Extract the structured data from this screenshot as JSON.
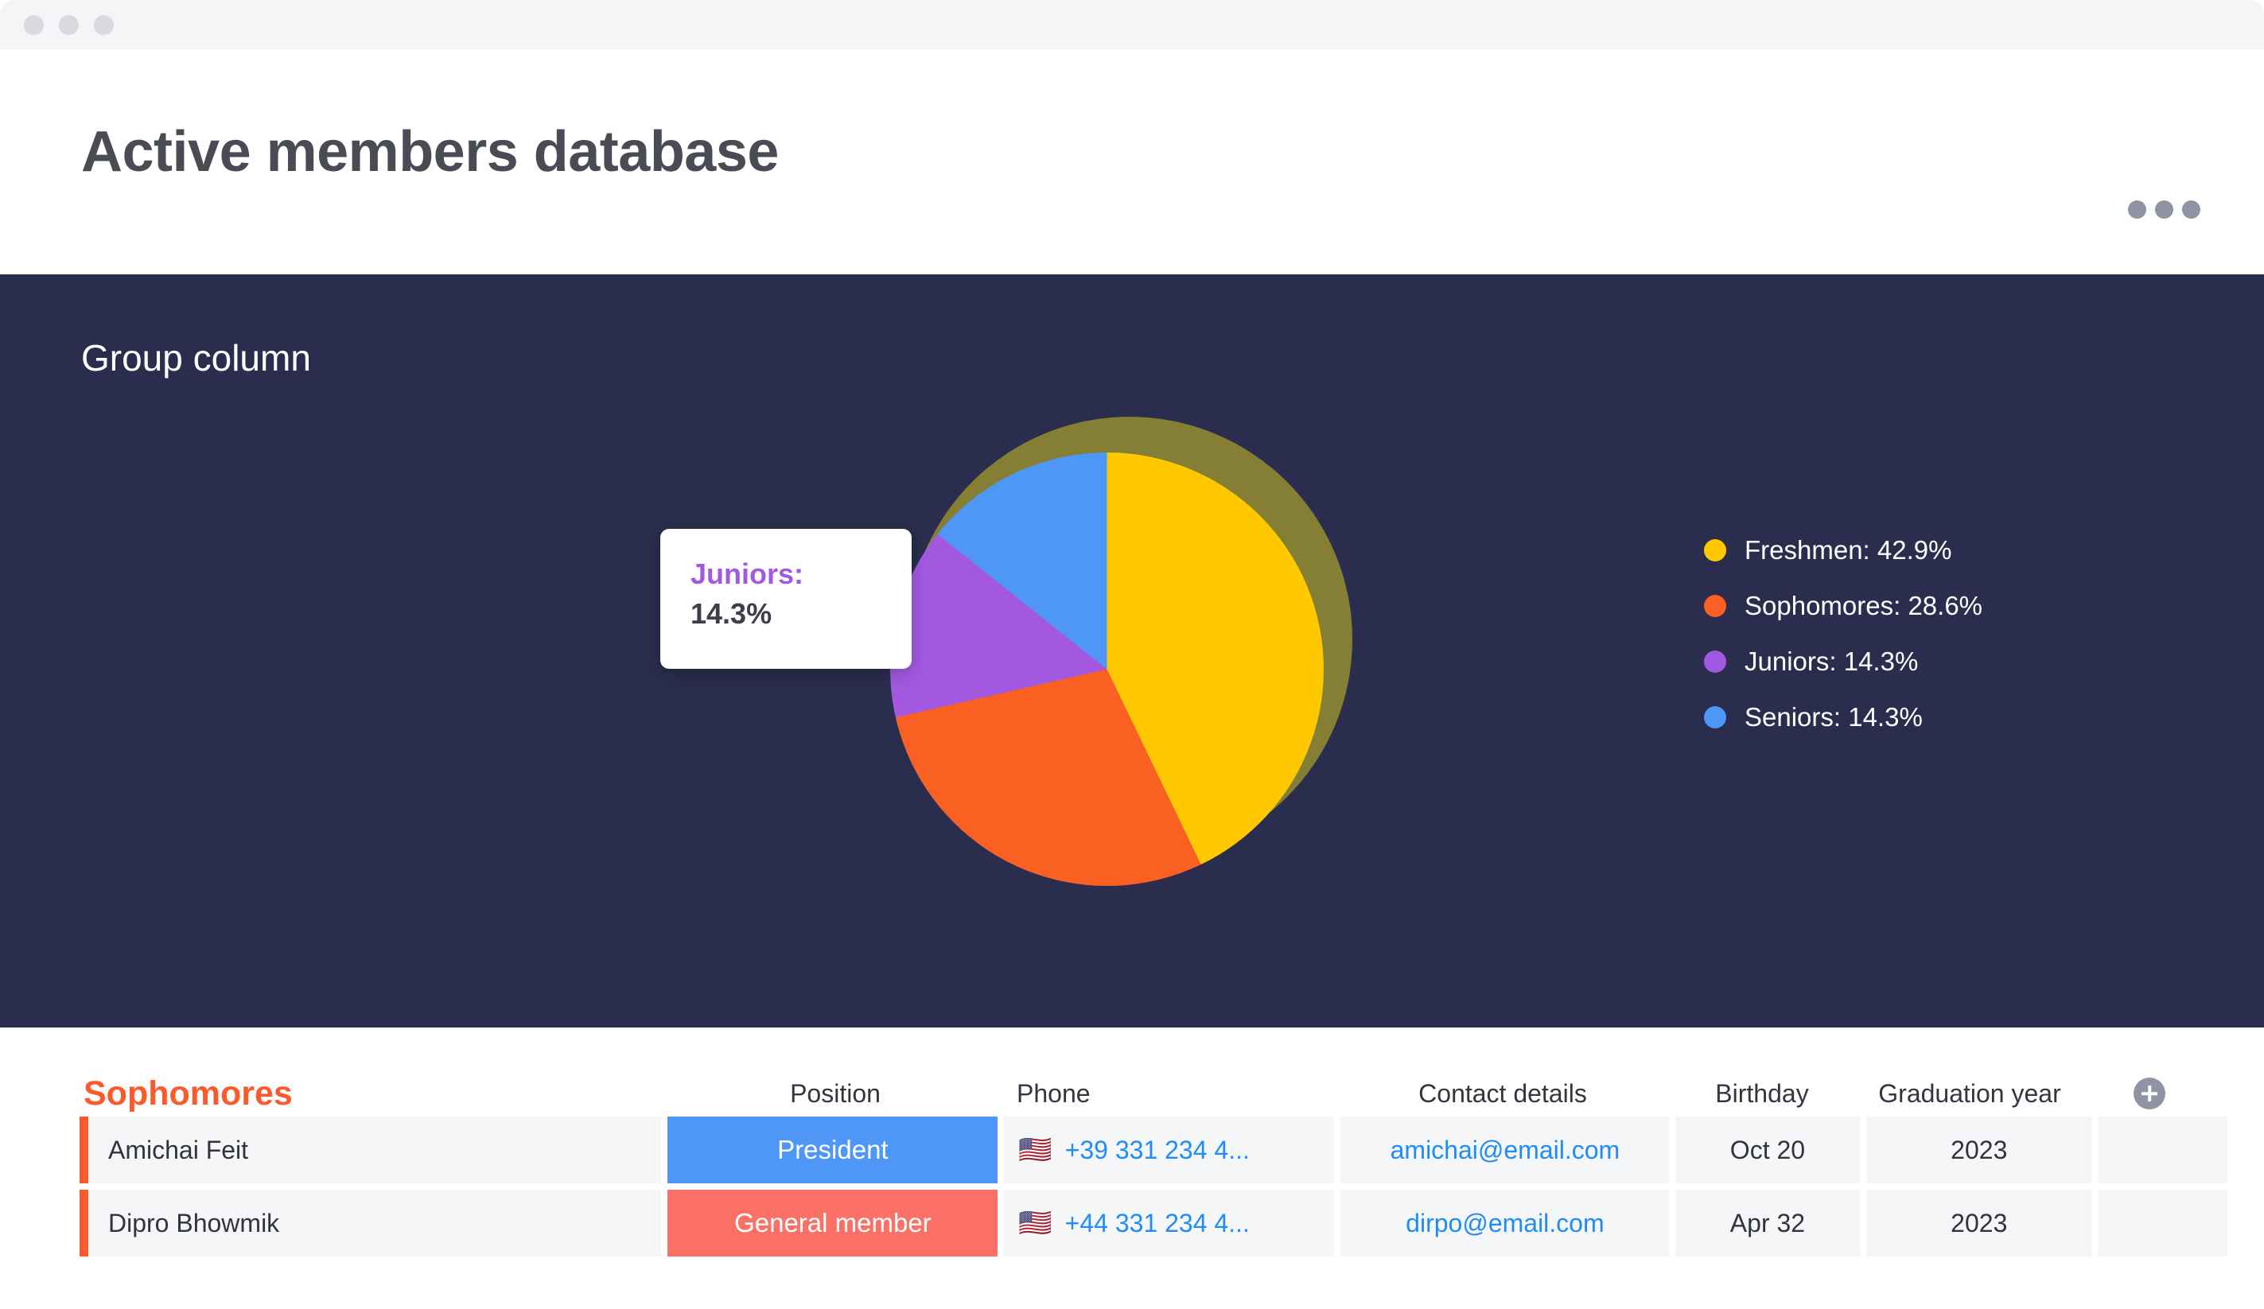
{
  "window": {
    "dots": [
      "close-dot",
      "minimize-dot",
      "maximize-dot"
    ]
  },
  "header": {
    "title": "Active members database",
    "menu_icon": "ellipsis-icon"
  },
  "chart_panel": {
    "title": "Group column",
    "background": "#2a2d4d",
    "tooltip": {
      "label": "Juniors:",
      "value": "14.3%",
      "label_color": "#a259e0"
    }
  },
  "chart_data": {
    "type": "pie",
    "title": "Group column",
    "categories": [
      "Freshmen",
      "Sophomores",
      "Juniors",
      "Seniors"
    ],
    "values": [
      42.9,
      28.6,
      14.3,
      14.3
    ],
    "colors": [
      "#ffc800",
      "#fb6023",
      "#a259e0",
      "#4f97f7"
    ],
    "legend_position": "right",
    "legend": [
      {
        "label": "Freshmen: 42.9%",
        "color": "#ffc800"
      },
      {
        "label": "Sophomores: 28.6%",
        "color": "#fb6023"
      },
      {
        "label": "Juniors: 14.3%",
        "color": "#a259e0"
      },
      {
        "label": "Seniors: 14.3%",
        "color": "#4f97f7"
      }
    ],
    "highlighted_slice": "Freshmen",
    "hovered_slice": "Juniors",
    "annotations": [
      "Juniors: 14.3%"
    ]
  },
  "table": {
    "group_name": "Sophomores",
    "group_color": "#fb5a2d",
    "columns": [
      "Position",
      "Phone",
      "Contact details",
      "Birthday",
      "Graduation year"
    ],
    "add_column_icon": "plus-circle-icon",
    "rows": [
      {
        "name": "Amichai Feit",
        "position": "President",
        "position_color": "#4f97f7",
        "flag": "🇺🇸",
        "phone": "+39 331 234 4...",
        "email": "amichai@email.com",
        "birthday": "Oct 20",
        "graduation_year": "2023"
      },
      {
        "name": "Dipro Bhowmik",
        "position": "General member",
        "position_color": "#fb7168",
        "flag": "🇺🇸",
        "phone": "+44 331 234 4...",
        "email": "dirpo@email.com",
        "birthday": "Apr 32",
        "graduation_year": "2023"
      }
    ]
  }
}
